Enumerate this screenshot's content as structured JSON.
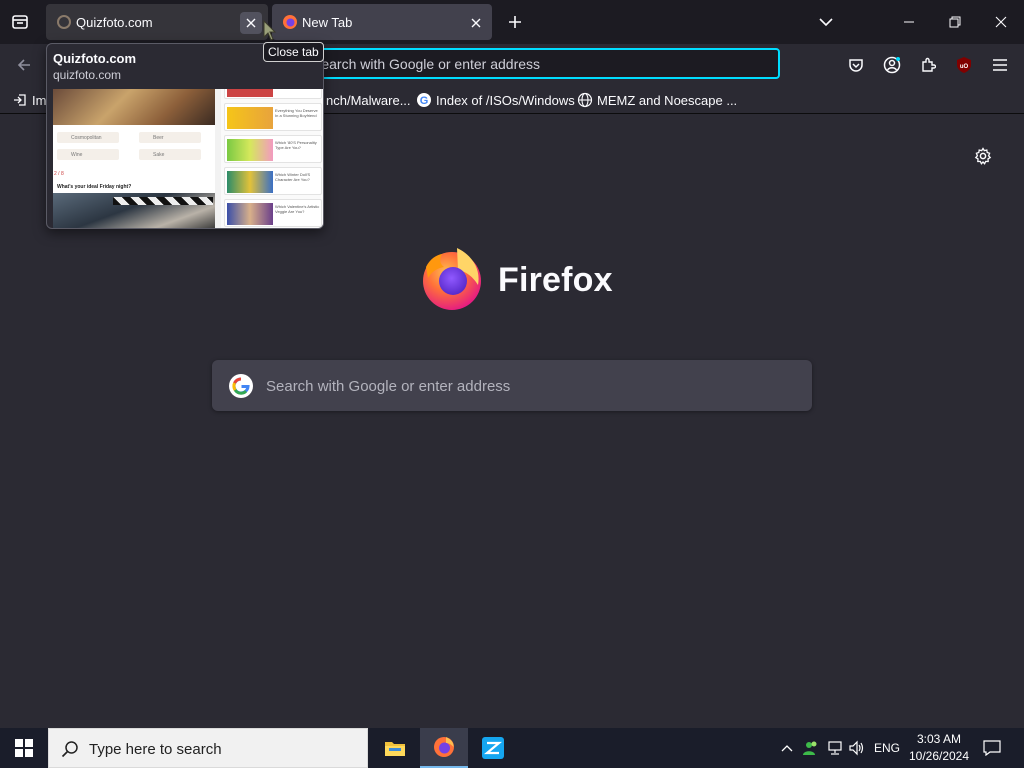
{
  "tabs": [
    {
      "title": "Quizfoto.com",
      "active": false,
      "close_icon": "close-icon"
    },
    {
      "title": "New Tab",
      "active": true,
      "close_icon": "close-icon"
    }
  ],
  "tooltip": "Close tab",
  "tab_preview": {
    "title": "Quizfoto.com",
    "url": "quizfoto.com",
    "thumbnail": {
      "question": "What's your ideal Friday night?",
      "counter": "2 / 8",
      "options": [
        "Cosmopolitan",
        "Beer",
        "Wine",
        "Sake"
      ],
      "side_items": [
        "Everything You Deserve In a Stunning Boyfriend",
        "Which '80'S Personality Type Are You?",
        "Which Winter Doll'S Character Are You?",
        "Which Valentine's Artistic Veggie Are You?"
      ]
    }
  },
  "navbar": {
    "url_placeholder": "Search with Google or enter address",
    "url_visible_text": "le or enter address"
  },
  "bookmarks": [
    {
      "label": "Im",
      "icon": "import-icon"
    },
    {
      "label": "nch/Malware...",
      "icon": ""
    },
    {
      "label": "Index of /ISOs/Windows",
      "icon": "google-icon"
    },
    {
      "label": "MEMZ and Noescape ...",
      "icon": "globe-icon"
    }
  ],
  "newtab": {
    "brand": "Firefox",
    "search_placeholder": "Search with Google or enter address"
  },
  "taskbar": {
    "search_placeholder": "Type here to search",
    "language": "ENG",
    "time": "3:03 AM",
    "date": "10/26/2024"
  },
  "colors": {
    "accent": "#00ddff",
    "background": "#2b2a33",
    "tabstrip": "#1c1b22",
    "taskbar": "#1a1d2a"
  }
}
